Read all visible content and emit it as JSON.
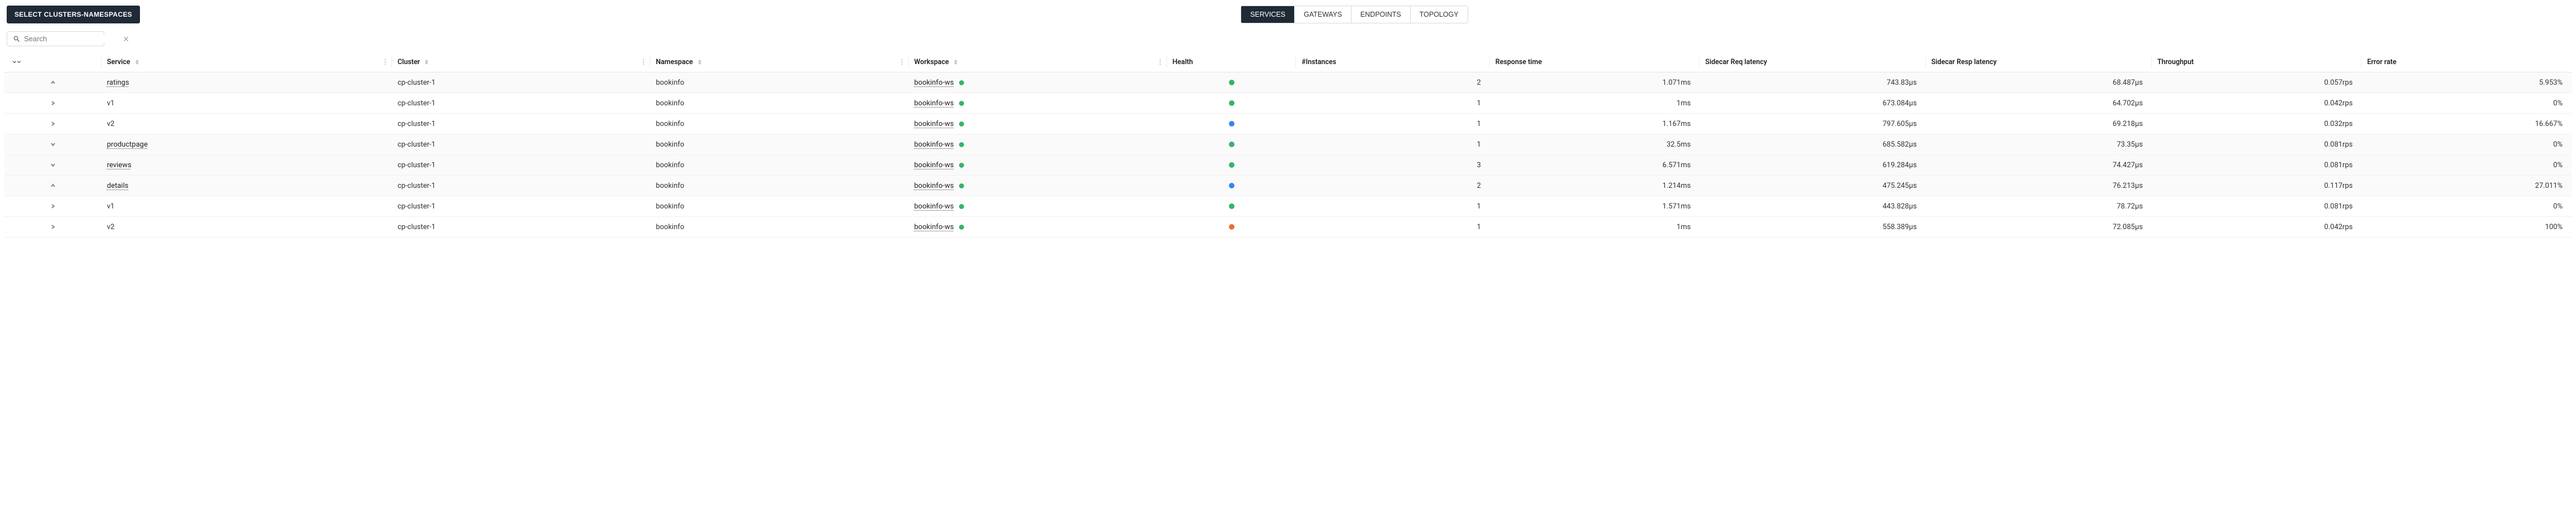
{
  "toolbar": {
    "select_label": "SELECT CLUSTERS-NAMESPACES",
    "tabs": [
      "SERVICES",
      "GATEWAYS",
      "ENDPOINTS",
      "TOPOLOGY"
    ],
    "active_tab": 0
  },
  "search": {
    "placeholder": "Search",
    "value": ""
  },
  "columns": {
    "service": "Service",
    "cluster": "Cluster",
    "namespace": "Namespace",
    "workspace": "Workspace",
    "health": "Health",
    "instances": "#Instances",
    "response_time": "Response time",
    "sidecar_req": "Sidecar Req latency",
    "sidecar_resp": "Sidecar Resp latency",
    "throughput": "Throughput",
    "error_rate": "Error rate"
  },
  "workspace_name": "bookinfo-ws",
  "rows": [
    {
      "type": "parent",
      "expand": "up",
      "service": "ratings",
      "cluster": "cp-cluster-1",
      "namespace": "bookinfo",
      "health": "green",
      "instances": "2",
      "response_time": "1.071ms",
      "req": "743.83µs",
      "resp": "68.487µs",
      "thr": "0.057rps",
      "err": "5.953%"
    },
    {
      "type": "child",
      "expand": "right",
      "service": "v1",
      "cluster": "cp-cluster-1",
      "namespace": "bookinfo",
      "health": "green",
      "instances": "1",
      "response_time": "1ms",
      "req": "673.084µs",
      "resp": "64.702µs",
      "thr": "0.042rps",
      "err": "0%"
    },
    {
      "type": "child",
      "expand": "right",
      "service": "v2",
      "cluster": "cp-cluster-1",
      "namespace": "bookinfo",
      "health": "blue",
      "instances": "1",
      "response_time": "1.167ms",
      "req": "797.605µs",
      "resp": "69.218µs",
      "thr": "0.032rps",
      "err": "16.667%"
    },
    {
      "type": "parent",
      "expand": "down",
      "service": "productpage",
      "cluster": "cp-cluster-1",
      "namespace": "bookinfo",
      "health": "green",
      "instances": "1",
      "response_time": "32.5ms",
      "req": "685.582µs",
      "resp": "73.35µs",
      "thr": "0.081rps",
      "err": "0%"
    },
    {
      "type": "parent",
      "expand": "down",
      "service": "reviews",
      "cluster": "cp-cluster-1",
      "namespace": "bookinfo",
      "health": "green",
      "instances": "3",
      "response_time": "6.571ms",
      "req": "619.284µs",
      "resp": "74.427µs",
      "thr": "0.081rps",
      "err": "0%"
    },
    {
      "type": "parent",
      "expand": "up",
      "service": "details",
      "cluster": "cp-cluster-1",
      "namespace": "bookinfo",
      "health": "blue",
      "instances": "2",
      "response_time": "1.214ms",
      "req": "475.245µs",
      "resp": "76.213µs",
      "thr": "0.117rps",
      "err": "27.011%"
    },
    {
      "type": "child",
      "expand": "right",
      "service": "v1",
      "cluster": "cp-cluster-1",
      "namespace": "bookinfo",
      "health": "green",
      "instances": "1",
      "response_time": "1.571ms",
      "req": "443.828µs",
      "resp": "78.72µs",
      "thr": "0.081rps",
      "err": "0%"
    },
    {
      "type": "child",
      "expand": "right",
      "service": "v2",
      "cluster": "cp-cluster-1",
      "namespace": "bookinfo",
      "health": "orange",
      "instances": "1",
      "response_time": "1ms",
      "req": "558.389µs",
      "resp": "72.085µs",
      "thr": "0.042rps",
      "err": "100%"
    }
  ]
}
